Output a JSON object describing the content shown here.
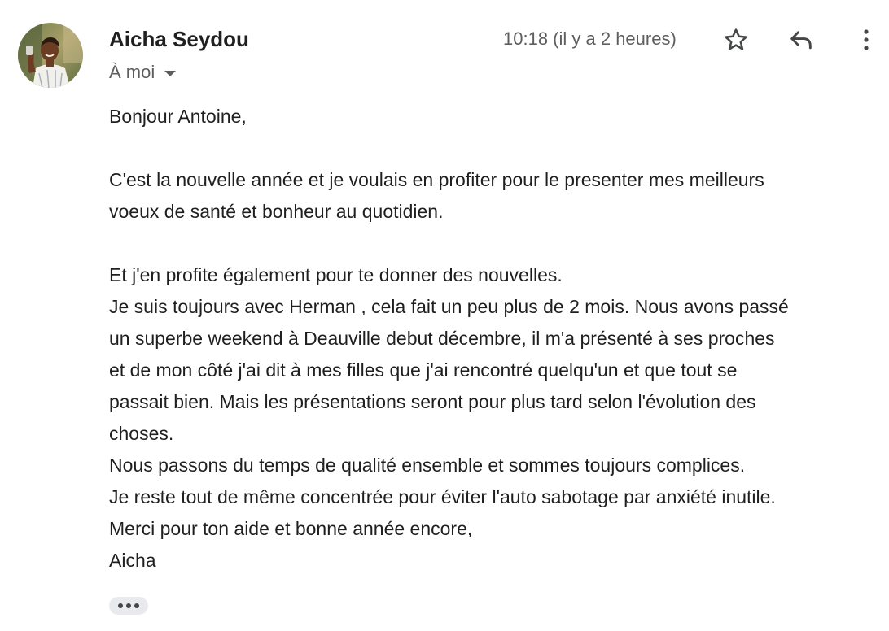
{
  "sender": {
    "name": "Aicha Seydou",
    "avatar_icon": "sender-avatar-photo"
  },
  "recipient": {
    "label": "À moi",
    "toggle_icon": "caret-down-icon"
  },
  "timestamp": "10:18 (il y a 2 heures)",
  "actions": {
    "star_icon": "star-icon",
    "reply_icon": "reply-icon",
    "more_icon": "more-vert-icon"
  },
  "body": {
    "greeting": "Bonjour Antoine,",
    "para1_lines": [
      "C'est la nouvelle année et je voulais en profiter pour le presenter mes meilleurs",
      "voeux de santé et bonheur au quotidien."
    ],
    "para2_lines": [
      "Et j'en profite également pour te donner des nouvelles.",
      "Je suis toujours avec Herman , cela fait un peu plus de 2 mois. Nous avons passé",
      "un superbe weekend à Deauville debut décembre, il m'a présenté à ses proches",
      "et de mon côté j'ai dit à mes filles que j'ai rencontré quelqu'un et que tout se",
      "passait bien. Mais les présentations seront pour plus tard selon l'évolution des",
      "choses.",
      "Nous passons du temps de qualité ensemble et sommes toujours complices.",
      "Je reste tout de même concentrée pour éviter l'auto sabotage par anxiété inutile.",
      "Merci pour ton aide et bonne année encore,",
      "Aicha"
    ]
  },
  "trimmed_content_icon": "more-horiz-icon",
  "colors": {
    "text_primary": "#1f1f1f",
    "text_secondary": "#5e5e5e",
    "chip_bg": "#e8eaed",
    "icon": "#444746"
  }
}
